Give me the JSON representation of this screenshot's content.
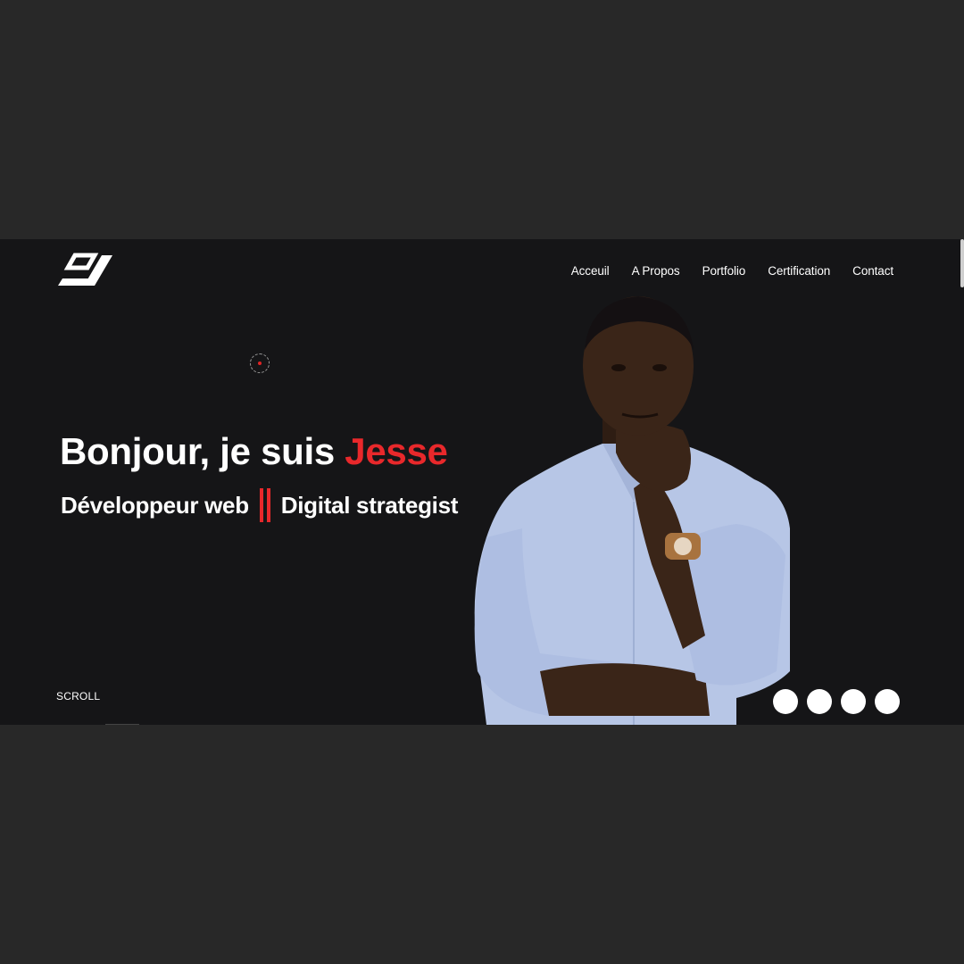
{
  "nav": {
    "items": [
      {
        "label": "Acceuil"
      },
      {
        "label": "A Propos"
      },
      {
        "label": "Portfolio"
      },
      {
        "label": "Certification"
      },
      {
        "label": "Contact"
      }
    ]
  },
  "hero": {
    "greeting": "Bonjour, je suis ",
    "name": "Jesse",
    "role_1": "Développeur web",
    "role_2": "Digital strategist"
  },
  "scroll_label": "SCROLL",
  "slider": {
    "dot_count": 4
  },
  "colors": {
    "page_background": "#282828",
    "hero_background": "#151517",
    "accent": "#e8282b",
    "text": "#ffffff",
    "shirt": "#b7c6e6",
    "skin": "#3a2518"
  },
  "icons": {
    "logo": "monogram-logo-icon",
    "cursor": "custom-cursor-icon"
  }
}
